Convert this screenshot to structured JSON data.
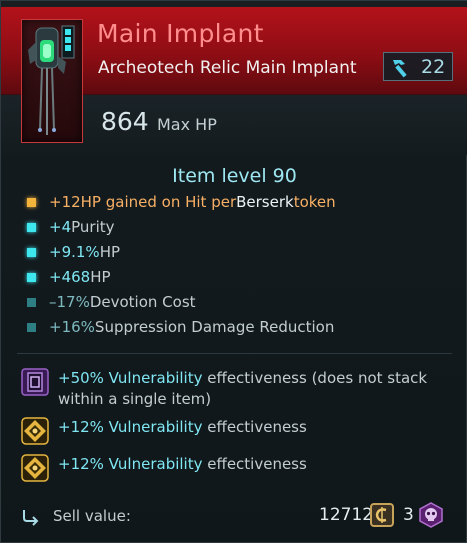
{
  "header": {
    "name": "Main Implant",
    "type": "Archeotech Relic Main Implant",
    "count": "22",
    "hp_value": "864",
    "hp_label": "Max HP"
  },
  "item_level": "Item level 90",
  "stats": [
    {
      "number": "+12",
      "segments": [
        [
          "HP gained on Hit per ",
          "gold"
        ],
        [
          "Berserk",
          "white"
        ],
        [
          " token",
          "gold"
        ]
      ],
      "bullet": "gold"
    },
    {
      "number": "+4",
      "segments": [
        [
          " Purity",
          "gray"
        ]
      ],
      "bullet": "cyan"
    },
    {
      "number": "+9.1%",
      "segments": [
        [
          " HP",
          "gray"
        ]
      ],
      "bullet": "cyan"
    },
    {
      "number": "+468",
      "segments": [
        [
          " HP",
          "gray"
        ]
      ],
      "bullet": "cyan"
    },
    {
      "number": "–17%",
      "segments": [
        [
          " Devotion Cost",
          "gray"
        ]
      ],
      "bullet": "teal"
    },
    {
      "number": "+16%",
      "segments": [
        [
          " Suppression Damage Reduction",
          "gray"
        ]
      ],
      "bullet": "teal"
    }
  ],
  "mods": [
    {
      "icon": "purple-chip-icon",
      "line1_pct": "+50% Vulnerability",
      "line1_rest": " effectiveness (does not stack",
      "line2": "within a single item)"
    },
    {
      "icon": "gold-ornate-icon",
      "line1_pct": "+12% Vulnerability",
      "line1_rest": " effectiveness",
      "line2": ""
    },
    {
      "icon": "gold-ornate-icon",
      "line1_pct": "+12% Vulnerability",
      "line1_rest": " effectiveness",
      "line2": ""
    }
  ],
  "sell": {
    "label": "Sell value:",
    "gold": "12712",
    "skull_count": "3"
  },
  "colors": {
    "header_red": "#b3121a",
    "name_pink": "#ff8d8d",
    "cyan": "#7fe6f2",
    "gold": "#f7b065"
  }
}
